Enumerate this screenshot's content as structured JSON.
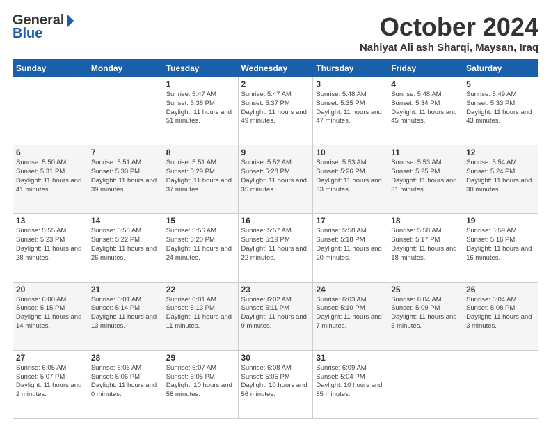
{
  "header": {
    "logo_line1": "General",
    "logo_line2": "Blue",
    "month": "October 2024",
    "location": "Nahiyat Ali ash Sharqi, Maysan, Iraq"
  },
  "days_of_week": [
    "Sunday",
    "Monday",
    "Tuesday",
    "Wednesday",
    "Thursday",
    "Friday",
    "Saturday"
  ],
  "weeks": [
    [
      {
        "day": "",
        "text": ""
      },
      {
        "day": "",
        "text": ""
      },
      {
        "day": "1",
        "text": "Sunrise: 5:47 AM\nSunset: 5:38 PM\nDaylight: 11 hours and 51 minutes."
      },
      {
        "day": "2",
        "text": "Sunrise: 5:47 AM\nSunset: 5:37 PM\nDaylight: 11 hours and 49 minutes."
      },
      {
        "day": "3",
        "text": "Sunrise: 5:48 AM\nSunset: 5:35 PM\nDaylight: 11 hours and 47 minutes."
      },
      {
        "day": "4",
        "text": "Sunrise: 5:48 AM\nSunset: 5:34 PM\nDaylight: 11 hours and 45 minutes."
      },
      {
        "day": "5",
        "text": "Sunrise: 5:49 AM\nSunset: 5:33 PM\nDaylight: 11 hours and 43 minutes."
      }
    ],
    [
      {
        "day": "6",
        "text": "Sunrise: 5:50 AM\nSunset: 5:31 PM\nDaylight: 11 hours and 41 minutes."
      },
      {
        "day": "7",
        "text": "Sunrise: 5:51 AM\nSunset: 5:30 PM\nDaylight: 11 hours and 39 minutes."
      },
      {
        "day": "8",
        "text": "Sunrise: 5:51 AM\nSunset: 5:29 PM\nDaylight: 11 hours and 37 minutes."
      },
      {
        "day": "9",
        "text": "Sunrise: 5:52 AM\nSunset: 5:28 PM\nDaylight: 11 hours and 35 minutes."
      },
      {
        "day": "10",
        "text": "Sunrise: 5:53 AM\nSunset: 5:26 PM\nDaylight: 11 hours and 33 minutes."
      },
      {
        "day": "11",
        "text": "Sunrise: 5:53 AM\nSunset: 5:25 PM\nDaylight: 11 hours and 31 minutes."
      },
      {
        "day": "12",
        "text": "Sunrise: 5:54 AM\nSunset: 5:24 PM\nDaylight: 11 hours and 30 minutes."
      }
    ],
    [
      {
        "day": "13",
        "text": "Sunrise: 5:55 AM\nSunset: 5:23 PM\nDaylight: 11 hours and 28 minutes."
      },
      {
        "day": "14",
        "text": "Sunrise: 5:55 AM\nSunset: 5:22 PM\nDaylight: 11 hours and 26 minutes."
      },
      {
        "day": "15",
        "text": "Sunrise: 5:56 AM\nSunset: 5:20 PM\nDaylight: 11 hours and 24 minutes."
      },
      {
        "day": "16",
        "text": "Sunrise: 5:57 AM\nSunset: 5:19 PM\nDaylight: 11 hours and 22 minutes."
      },
      {
        "day": "17",
        "text": "Sunrise: 5:58 AM\nSunset: 5:18 PM\nDaylight: 11 hours and 20 minutes."
      },
      {
        "day": "18",
        "text": "Sunrise: 5:58 AM\nSunset: 5:17 PM\nDaylight: 11 hours and 18 minutes."
      },
      {
        "day": "19",
        "text": "Sunrise: 5:59 AM\nSunset: 5:16 PM\nDaylight: 11 hours and 16 minutes."
      }
    ],
    [
      {
        "day": "20",
        "text": "Sunrise: 6:00 AM\nSunset: 5:15 PM\nDaylight: 11 hours and 14 minutes."
      },
      {
        "day": "21",
        "text": "Sunrise: 6:01 AM\nSunset: 5:14 PM\nDaylight: 11 hours and 13 minutes."
      },
      {
        "day": "22",
        "text": "Sunrise: 6:01 AM\nSunset: 5:13 PM\nDaylight: 11 hours and 11 minutes."
      },
      {
        "day": "23",
        "text": "Sunrise: 6:02 AM\nSunset: 5:11 PM\nDaylight: 11 hours and 9 minutes."
      },
      {
        "day": "24",
        "text": "Sunrise: 6:03 AM\nSunset: 5:10 PM\nDaylight: 11 hours and 7 minutes."
      },
      {
        "day": "25",
        "text": "Sunrise: 6:04 AM\nSunset: 5:09 PM\nDaylight: 11 hours and 5 minutes."
      },
      {
        "day": "26",
        "text": "Sunrise: 6:04 AM\nSunset: 5:08 PM\nDaylight: 11 hours and 3 minutes."
      }
    ],
    [
      {
        "day": "27",
        "text": "Sunrise: 6:05 AM\nSunset: 5:07 PM\nDaylight: 11 hours and 2 minutes."
      },
      {
        "day": "28",
        "text": "Sunrise: 6:06 AM\nSunset: 5:06 PM\nDaylight: 11 hours and 0 minutes."
      },
      {
        "day": "29",
        "text": "Sunrise: 6:07 AM\nSunset: 5:05 PM\nDaylight: 10 hours and 58 minutes."
      },
      {
        "day": "30",
        "text": "Sunrise: 6:08 AM\nSunset: 5:05 PM\nDaylight: 10 hours and 56 minutes."
      },
      {
        "day": "31",
        "text": "Sunrise: 6:09 AM\nSunset: 5:04 PM\nDaylight: 10 hours and 55 minutes."
      },
      {
        "day": "",
        "text": ""
      },
      {
        "day": "",
        "text": ""
      }
    ]
  ]
}
